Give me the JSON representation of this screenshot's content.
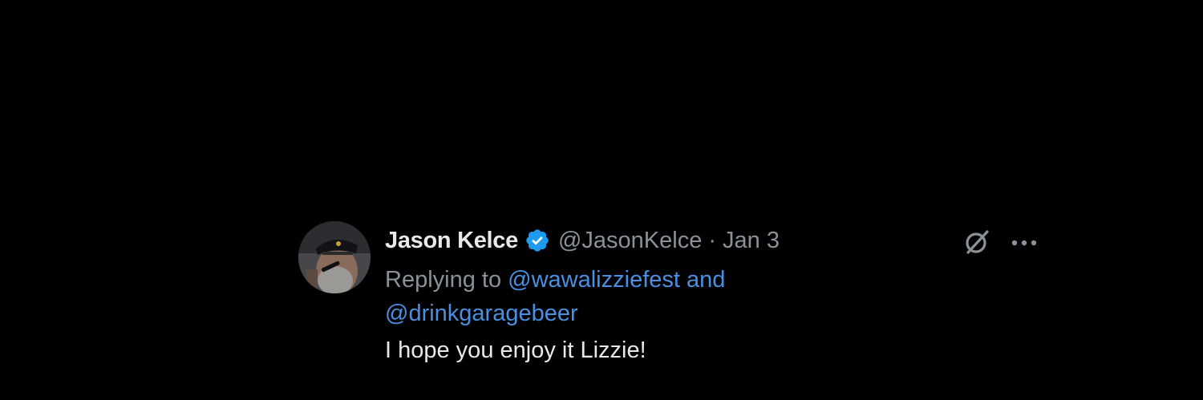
{
  "tweet": {
    "author": {
      "display_name": "Jason Kelce",
      "handle": "@JasonKelce",
      "verified": true
    },
    "separator": "·",
    "date": "Jan 3",
    "replying_prefix": "Replying to",
    "mention_1": "@wawalizziefest",
    "conjunction": "and",
    "mention_2": "@drinkgaragebeer",
    "text": "I hope you enjoy it Lizzie!",
    "icons": {
      "grok": "grok-icon",
      "more": "more-options-icon",
      "verified": "verified-badge-icon"
    },
    "colors": {
      "background": "#000000",
      "primary_text": "#e7e9ea",
      "secondary_text": "#8b9198",
      "link": "#4a90e2",
      "verified": "#1d9bf0"
    }
  }
}
